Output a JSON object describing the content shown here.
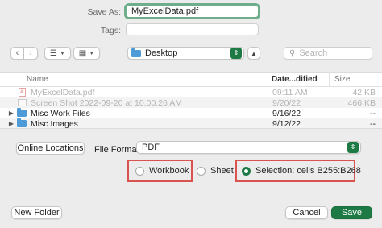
{
  "save_as": {
    "label": "Save As:",
    "value": "MyExcelData.pdf"
  },
  "tags": {
    "label": "Tags:",
    "value": ""
  },
  "toolbar": {
    "back_icon": "chevron-left-icon",
    "forward_icon": "chevron-right-icon",
    "location": "Desktop",
    "search_placeholder": "Search"
  },
  "columns": {
    "name": "Name",
    "date": "Date...dified",
    "size": "Size"
  },
  "files": [
    {
      "name": "MyExcelData.pdf",
      "date": "09:11 AM",
      "size": "42 KB",
      "kind": "pdf",
      "dim": true,
      "disclosure": false
    },
    {
      "name": "Screen Shot 2022-09-20 at 10.00.26 AM",
      "date": "9/20/22",
      "size": "466 KB",
      "kind": "image",
      "dim": true,
      "disclosure": false
    },
    {
      "name": "Misc Work Files",
      "date": "9/16/22",
      "size": "--",
      "kind": "folder",
      "dim": false,
      "disclosure": true
    },
    {
      "name": "Misc Images",
      "date": "9/12/22",
      "size": "--",
      "kind": "folder",
      "dim": false,
      "disclosure": true
    }
  ],
  "online_locations_label": "Online Locations",
  "file_format": {
    "label": "File Format:",
    "value": "PDF"
  },
  "options": {
    "workbook": "Workbook",
    "sheet": "Sheet",
    "selection": "Selection: cells B255:B268",
    "selected": "selection"
  },
  "buttons": {
    "new_folder": "New Folder",
    "cancel": "Cancel",
    "save": "Save"
  },
  "colors": {
    "accent": "#1e7a45",
    "highlight": "#d9534f",
    "focus_ring": "#6fae8c"
  }
}
